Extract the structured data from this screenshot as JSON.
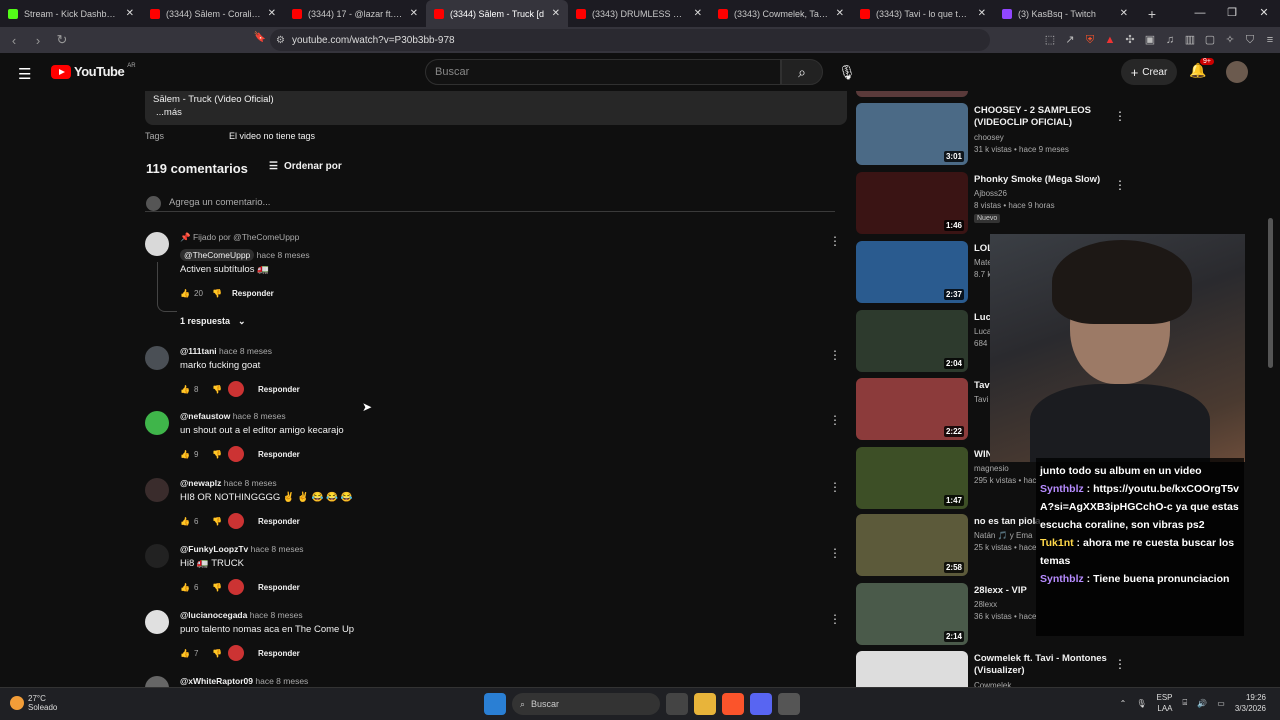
{
  "browser": {
    "tabs": [
      {
        "title": "Stream - Kick Dashboard",
        "color": "#53fc18"
      },
      {
        "title": "(3344) Sālem - Coraline [dir. @",
        "color": "#ff0000"
      },
      {
        "title": "(3344) 17 - @lazar ft. @ceroas",
        "color": "#ff0000"
      },
      {
        "title": "(3344) Sālem - Truck [d",
        "color": "#ff0000",
        "active": true
      },
      {
        "title": "(3343) DRUMLESS & SOUL #1",
        "color": "#ff0000"
      },
      {
        "title": "(3343) Cowmelek, Tavi - Proble",
        "color": "#ff0000"
      },
      {
        "title": "(3343) Tavi - lo que tengo guar",
        "color": "#ff0000"
      },
      {
        "title": "(3) KasBsq - Twitch",
        "color": "#9146ff"
      }
    ],
    "url": "youtube.com/watch?v=P30b3bb-978"
  },
  "yt": {
    "logo": "YouTube",
    "country": "AR",
    "search_placeholder": "Buscar",
    "create_label": "Crear",
    "notif_count": "9+"
  },
  "description": {
    "line1": "Sālem - Truck (Video Oficial)",
    "more": "...más"
  },
  "tags": {
    "label": "Tags",
    "value": "El video no tiene tags"
  },
  "comments_header": {
    "count": "119 comentarios",
    "sort": "Ordenar por",
    "placeholder": "Agrega un comentario..."
  },
  "comments": [
    {
      "pinned": "Fijado por @TheComeUppp",
      "user": "@TheComeUppp",
      "time": "hace 8 meses",
      "text": "Activen subtítulos 🚛",
      "likes": "20",
      "reply": "Responder",
      "replies": "1 respuesta",
      "avatar_color": "#d9d9d9"
    },
    {
      "user": "@111tani",
      "time": "hace 8 meses",
      "text": "marko fucking goat",
      "likes": "8",
      "reply": "Responder",
      "avatar_color": "#4a4f55"
    },
    {
      "user": "@nefaustow",
      "time": "hace 8 meses",
      "text": "un shout out a el editor amigo kecarajo",
      "likes": "9",
      "reply": "Responder",
      "avatar_color": "#3fb54a"
    },
    {
      "user": "@newaplz",
      "time": "hace 8 meses",
      "text": "HI8 OR NOTHINGGGG ✌ ✌ 😂 😂 😂",
      "likes": "6",
      "reply": "Responder",
      "avatar_color": "#3a2c2c"
    },
    {
      "user": "@FunkyLoopzTv",
      "time": "hace 8 meses",
      "text": "Hi8 🚛 TRUCK",
      "likes": "6",
      "reply": "Responder",
      "avatar_color": "#222222"
    },
    {
      "user": "@lucianocegada",
      "time": "hace 8 meses",
      "text": "puro talento nomas aca en The Come Up",
      "likes": "7",
      "reply": "Responder",
      "avatar_color": "#e0e0e0"
    },
    {
      "user": "@xWhiteRaptor09",
      "time": "hace 8 meses",
      "text": "",
      "likes": "",
      "reply": "",
      "avatar_color": "#666666"
    }
  ],
  "sidebar": [
    {
      "title": "CHOOSEY - 2 SAMPLEOS (VIDEOCLIP OFICIAL)",
      "channel": "choosey",
      "stats": "31 k vistas • hace 9 meses",
      "duration": "3:01",
      "thumb": "#4b6a86"
    },
    {
      "title": "Phonky Smoke (Mega Slow)",
      "channel": "Ajboss26",
      "stats": "8 vistas • hace 9 horas",
      "duration": "1:46",
      "badge": "Nuevo",
      "thumb": "#3a1414"
    },
    {
      "title": "LOL",
      "channel": "Mate",
      "stats": "8.7 k",
      "duration": "2:37",
      "thumb": "#2a5b8f"
    },
    {
      "title": "Luca (Vid",
      "channel": "Luca",
      "stats": "684",
      "duration": "2:04",
      "thumb": "#2d3a2d"
    },
    {
      "title": "Tavi Ofic",
      "channel": "Tavi",
      "stats": "",
      "duration": "2:22",
      "thumb": "#8c3b3b"
    },
    {
      "title": "WIN",
      "channel": "magnesio",
      "stats": "295 k vistas • hac",
      "duration": "1:47",
      "thumb": "#3d4f26"
    },
    {
      "title": "no es tan piola",
      "channel": "Natán 🎵 y Ema",
      "stats": "25 k vistas • hace",
      "duration": "2:58",
      "thumb": "#5c5a3a"
    },
    {
      "title": "28lexx - VIP",
      "channel": "28lexx",
      "stats": "36 k vistas • hace",
      "duration": "2:14",
      "thumb": "#4a5a4a"
    },
    {
      "title": "Cowmelek ft. Tavi - Montones (Visualizer)",
      "channel": "Cowmelek",
      "stats": "",
      "duration": "",
      "thumb": "#dddddd"
    }
  ],
  "chat": [
    {
      "text": "junto todo su album en un video"
    },
    {
      "user": "Synthblz",
      "text": "https://youtu.be/kxCOOrgT5vA?si=AgXXB3ipHGCchO-c ya que estas escucha coraline, son vibras ps2"
    },
    {
      "user": "Tuk1nt",
      "text": "ahora me re cuesta buscar los temas"
    },
    {
      "user": "Synthblz",
      "text": "Tiene buena pronunciacion"
    }
  ],
  "taskbar": {
    "temp": "27°C",
    "weather": "Soleado",
    "search": "Buscar",
    "lang1": "ESP",
    "lang2": "LAA",
    "time": "19:26",
    "date": "3/3/2026"
  }
}
